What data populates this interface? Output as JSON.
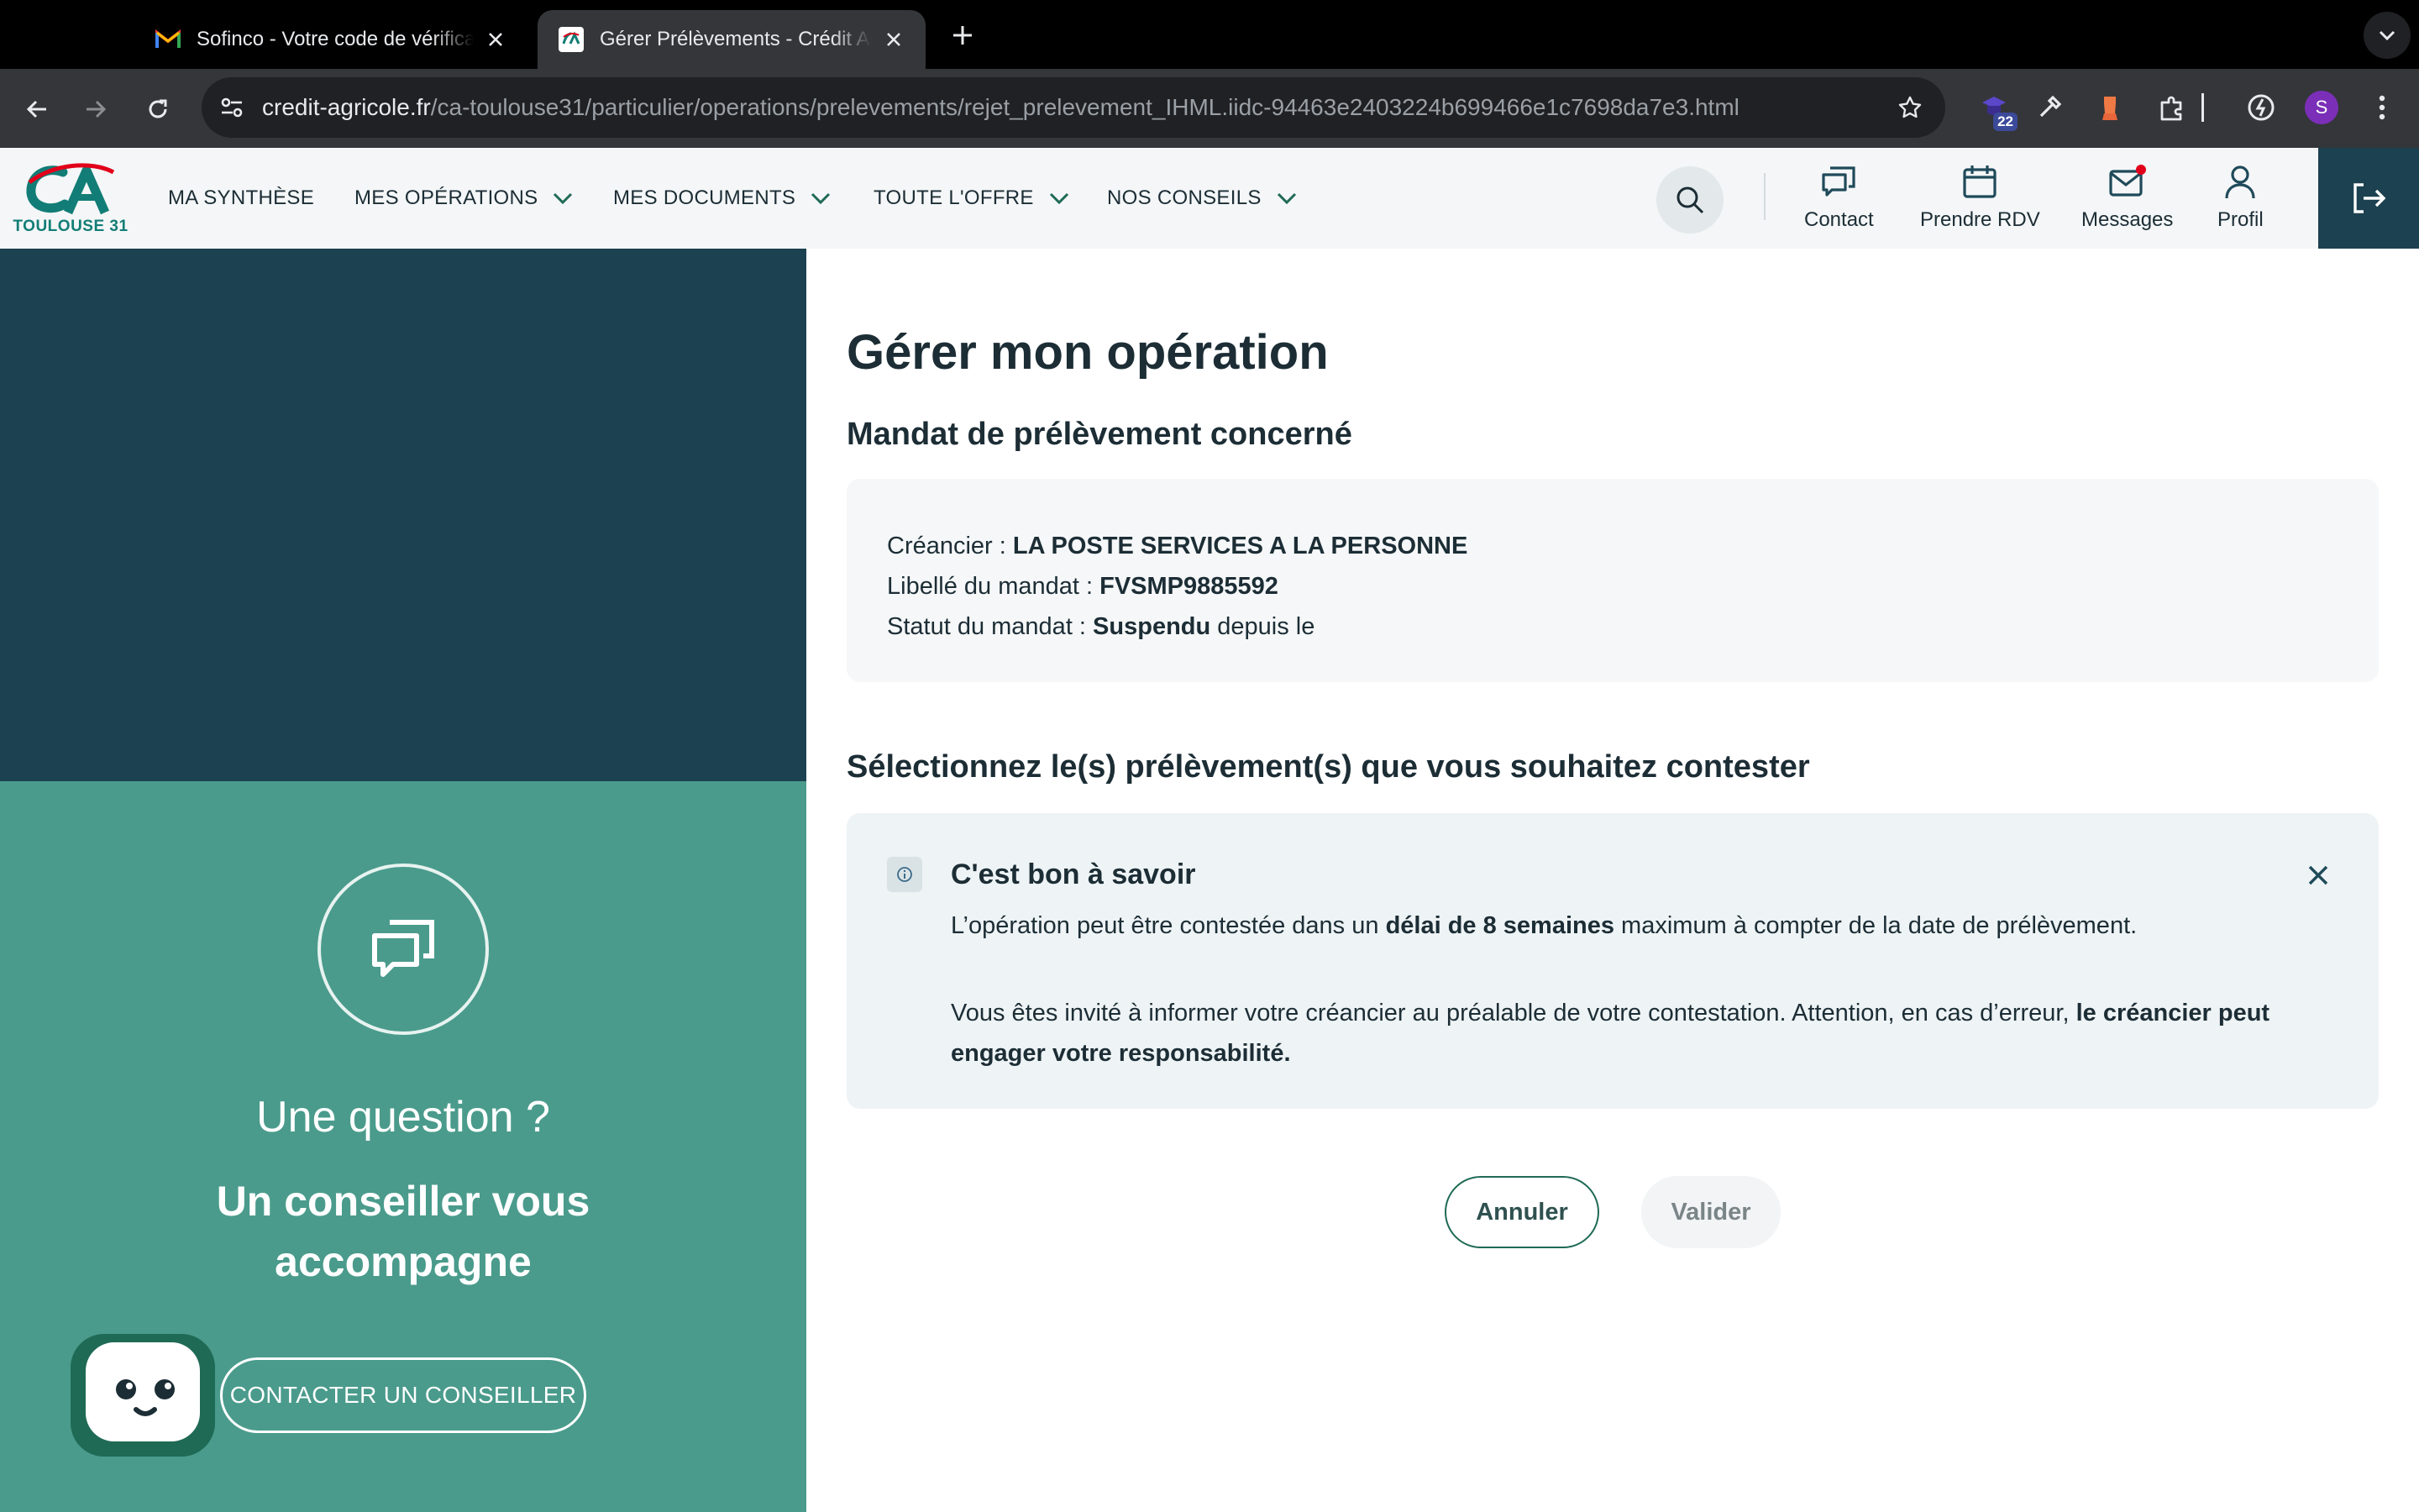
{
  "browser": {
    "tabs": [
      {
        "title": "Sofinco - Votre code de vérification"
      },
      {
        "title": "Gérer Prélèvements - Crédit Agricole"
      }
    ],
    "url_domain": "credit-agricole.fr",
    "url_path": "/ca-toulouse31/particulier/operations/prelevements/rejet_prelevement_IHML.iidc-94463e2403224b699466e1c7698da7e3.html",
    "extension_badge": "22",
    "profile_initial": "S"
  },
  "header": {
    "logo_sub": "TOULOUSE 31",
    "menu": [
      {
        "label": "MA SYNTHÈSE"
      },
      {
        "label": "MES OPÉRATIONS"
      },
      {
        "label": "MES DOCUMENTS"
      },
      {
        "label": "TOUTE L'OFFRE"
      },
      {
        "label": "NOS CONSEILS"
      }
    ],
    "actions": {
      "contact": "Contact",
      "rdv": "Prendre RDV",
      "messages": "Messages",
      "profil": "Profil"
    }
  },
  "sidebar": {
    "question": "Une question ?",
    "advisor_line1": "Un conseiller vous",
    "advisor_line2": "accompagne",
    "contact_button": "CONTACTER UN CONSEILLER"
  },
  "main": {
    "title": "Gérer mon opération",
    "mandat_heading": "Mandat de prélèvement concerné",
    "mandat": {
      "creancier_label": "Créancier : ",
      "creancier_value": "LA POSTE SERVICES A LA PERSONNE",
      "libelle_label": "Libellé du mandat : ",
      "libelle_value": "FVSMP9885592",
      "statut_label": "Statut du mandat : ",
      "statut_value": "Suspendu",
      "statut_suffix": " depuis le"
    },
    "select_heading": "Sélectionnez le(s) prélèvement(s) que vous souhaitez contester",
    "info": {
      "title": "C'est bon à savoir",
      "p1_start": "L’opération peut être contestée dans un ",
      "p1_bold": "délai de 8 semaines",
      "p1_end": " maximum à compter de la date de prélèvement.",
      "p2_start": "Vous êtes invité à informer votre créancier au préalable de votre contestation. Attention, en cas d’erreur, ",
      "p2_bold": "le créancier peut engager votre responsabilité."
    },
    "buttons": {
      "cancel": "Annuler",
      "validate": "Valider"
    }
  }
}
